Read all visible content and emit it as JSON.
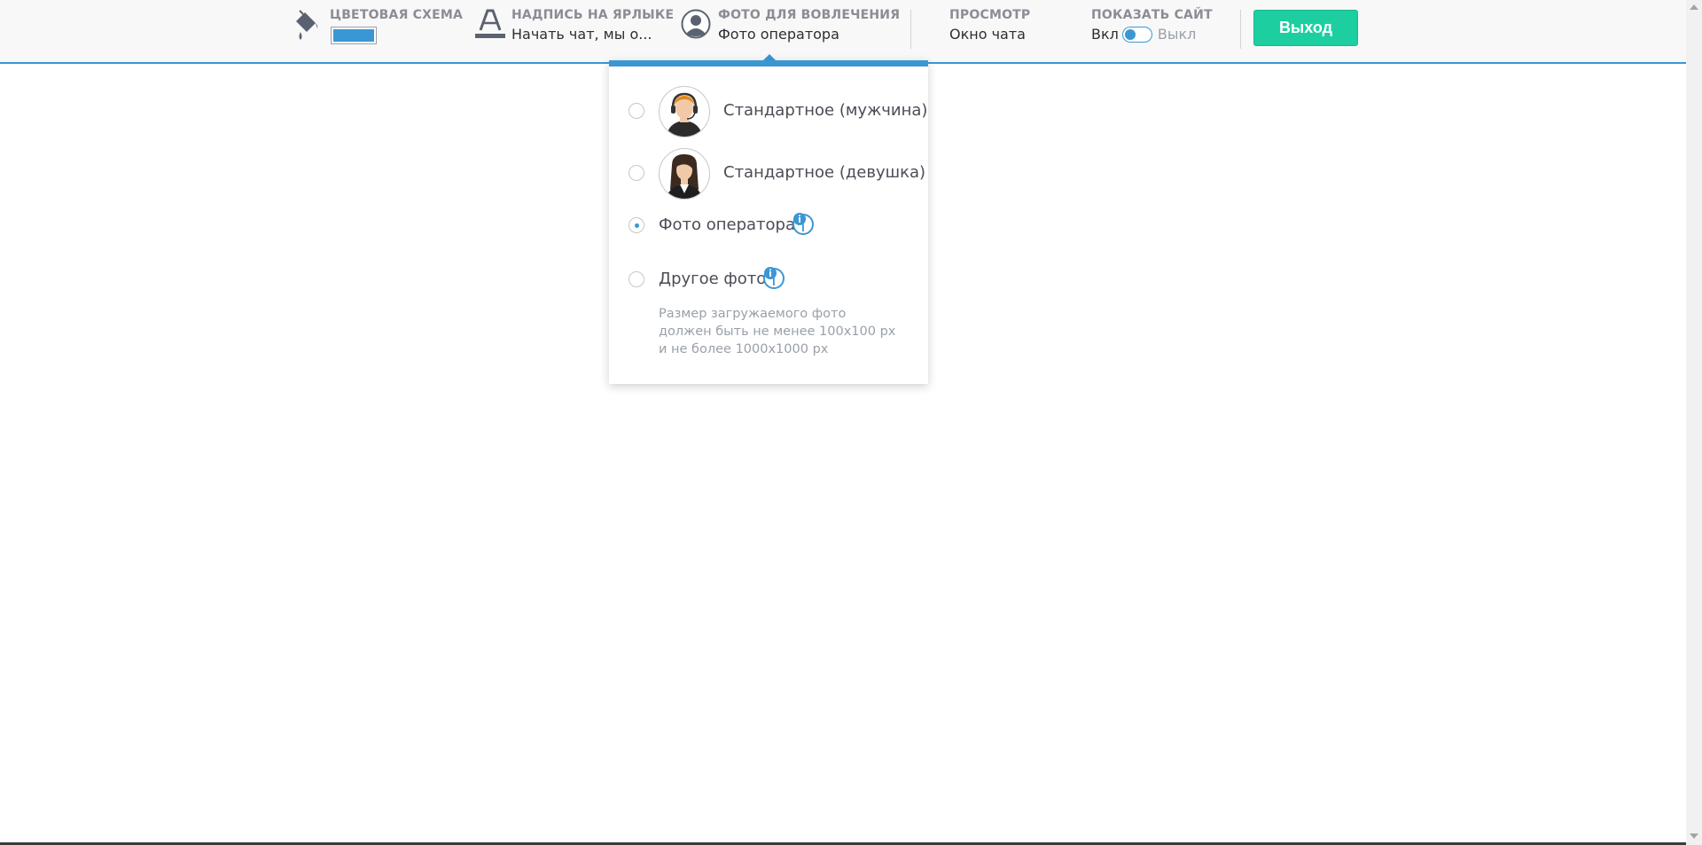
{
  "toolbar": {
    "color_scheme": {
      "label": "ЦВЕТОВАЯ СХЕМА",
      "swatch_color": "#3b97d3"
    },
    "badge_caption": {
      "label": "НАДПИСЬ НА ЯРЛЫКЕ",
      "value": "Начать чат, мы о..."
    },
    "engagement_photo": {
      "label": "ФОТО ДЛЯ ВОВЛЕЧЕНИЯ",
      "value": "Фото оператора"
    },
    "preview": {
      "label": "ПРОСМОТР",
      "value": "Окно чата"
    },
    "show_site": {
      "label": "ПОКАЗАТЬ САЙТ",
      "on_label": "Вкл",
      "off_label": "Выкл",
      "state": "on"
    },
    "exit_label": "Выход"
  },
  "dropdown": {
    "options": [
      {
        "label": "Стандартное (мужчина)",
        "checked": false,
        "avatar": "male-operator"
      },
      {
        "label": "Стандартное (девушка)",
        "checked": false,
        "avatar": "female-operator"
      },
      {
        "label": "Фото оператора",
        "checked": true,
        "info": true
      },
      {
        "label": "Другое фото",
        "checked": false,
        "info": true,
        "hint": [
          "Размер загружаемого фото",
          "должен быть не менее 100x100 px",
          "и не более 1000x1000 px"
        ]
      }
    ]
  },
  "colors": {
    "accent": "#3b97d3",
    "exit_button": "#1dcfa0"
  }
}
